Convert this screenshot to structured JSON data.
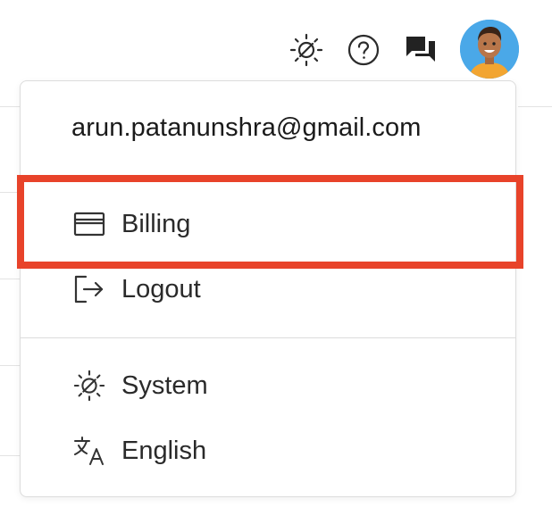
{
  "header": {
    "icons": {
      "theme": "theme-system-icon",
      "help": "help-circle-icon",
      "chat": "chat-icon",
      "avatar": "user-avatar"
    }
  },
  "menu": {
    "email": "arun.patanunshra@gmail.com",
    "items": [
      {
        "label": "Billing",
        "icon": "credit-card-icon"
      },
      {
        "label": "Logout",
        "icon": "logout-icon"
      },
      {
        "label": "System",
        "icon": "theme-system-icon"
      },
      {
        "label": "English",
        "icon": "translate-icon"
      }
    ]
  },
  "colors": {
    "highlight": "#e8432a",
    "avatar_bg": "#4aa8e8",
    "text": "#2a2a2a",
    "border": "#dcdcdc"
  }
}
